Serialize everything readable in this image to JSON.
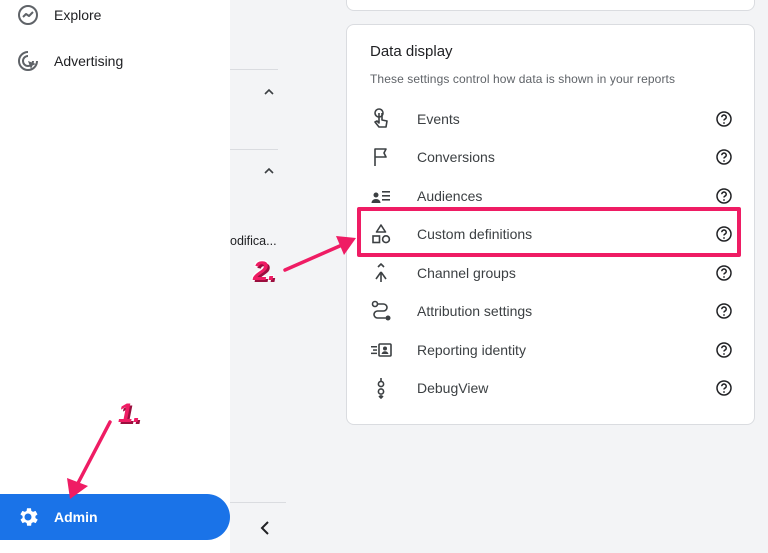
{
  "sidebar": {
    "items": [
      {
        "label": "Explore",
        "icon": "explore-icon"
      },
      {
        "label": "Advertising",
        "icon": "advertising-icon"
      }
    ],
    "admin": {
      "label": "Admin",
      "icon": "gear-icon"
    }
  },
  "middle": {
    "truncated_text": "odifica..."
  },
  "data_display": {
    "title": "Data display",
    "subtitle": "These settings control how data is shown in your reports",
    "items": [
      {
        "label": "Events",
        "icon": "touch-icon"
      },
      {
        "label": "Conversions",
        "icon": "flag-icon"
      },
      {
        "label": "Audiences",
        "icon": "audience-list-icon"
      },
      {
        "label": "Custom definitions",
        "icon": "shapes-icon"
      },
      {
        "label": "Channel groups",
        "icon": "merge-icon"
      },
      {
        "label": "Attribution settings",
        "icon": "attribution-path-icon"
      },
      {
        "label": "Reporting identity",
        "icon": "identity-icon"
      },
      {
        "label": "DebugView",
        "icon": "debug-view-icon"
      }
    ]
  },
  "annotations": {
    "step1": "1.",
    "step2": "2.",
    "color": "#ef1c64"
  },
  "colors": {
    "accent": "#1a73e8",
    "highlight": "#ef1c64"
  }
}
